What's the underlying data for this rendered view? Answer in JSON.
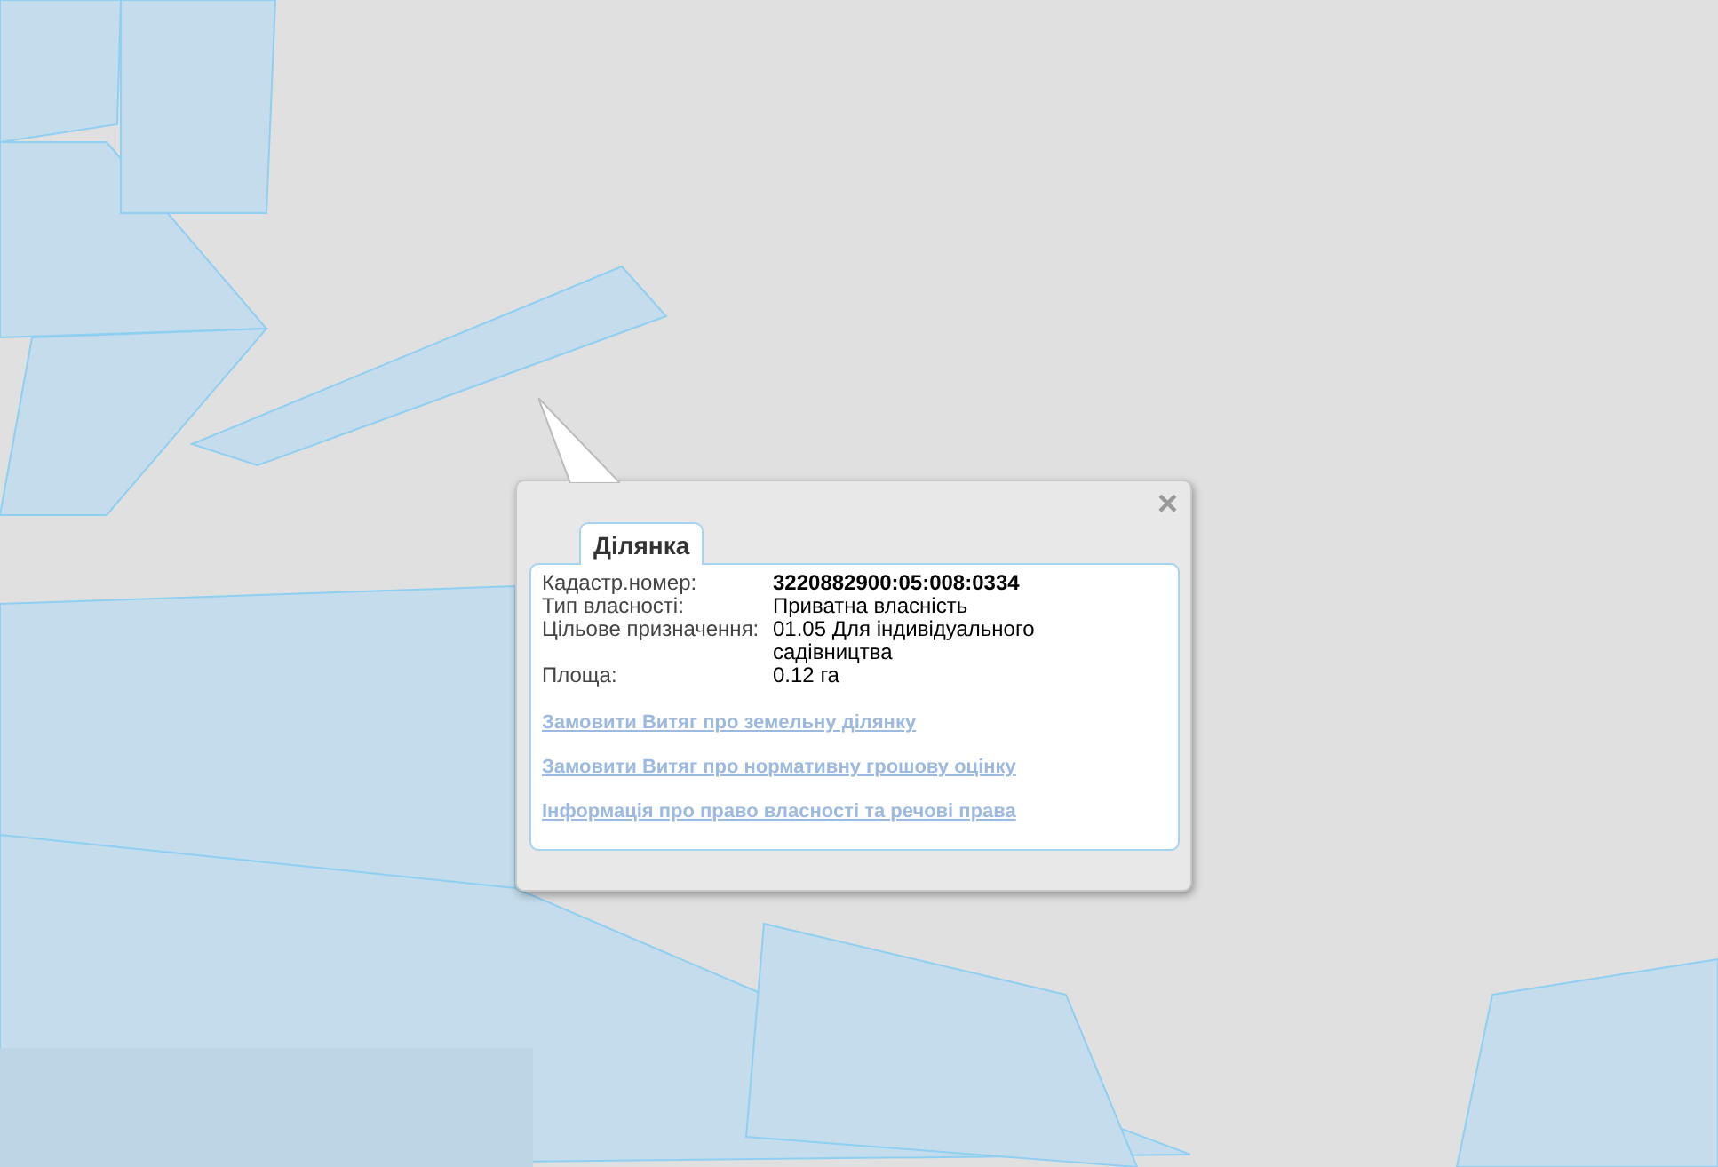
{
  "popup": {
    "close": "×",
    "tab": "Ділянка",
    "fields": [
      {
        "label": "Кадастр.номер:",
        "value": "3220882900:05:008:0334",
        "kind": "bold"
      },
      {
        "label": "Тип власності:",
        "value": "Приватна власність",
        "kind": "plain"
      },
      {
        "label": "Цільове призначення:",
        "value": "01.05 Для індивідуального садівництва",
        "kind": "plain"
      },
      {
        "label": "Площа:",
        "value": "0.12 га",
        "kind": "plain"
      }
    ],
    "links": [
      "Замовити Витяг про земельну ділянку",
      "Замовити Витяг про нормативну грошову оцінку",
      "Інформація про право власності та речові права"
    ]
  }
}
